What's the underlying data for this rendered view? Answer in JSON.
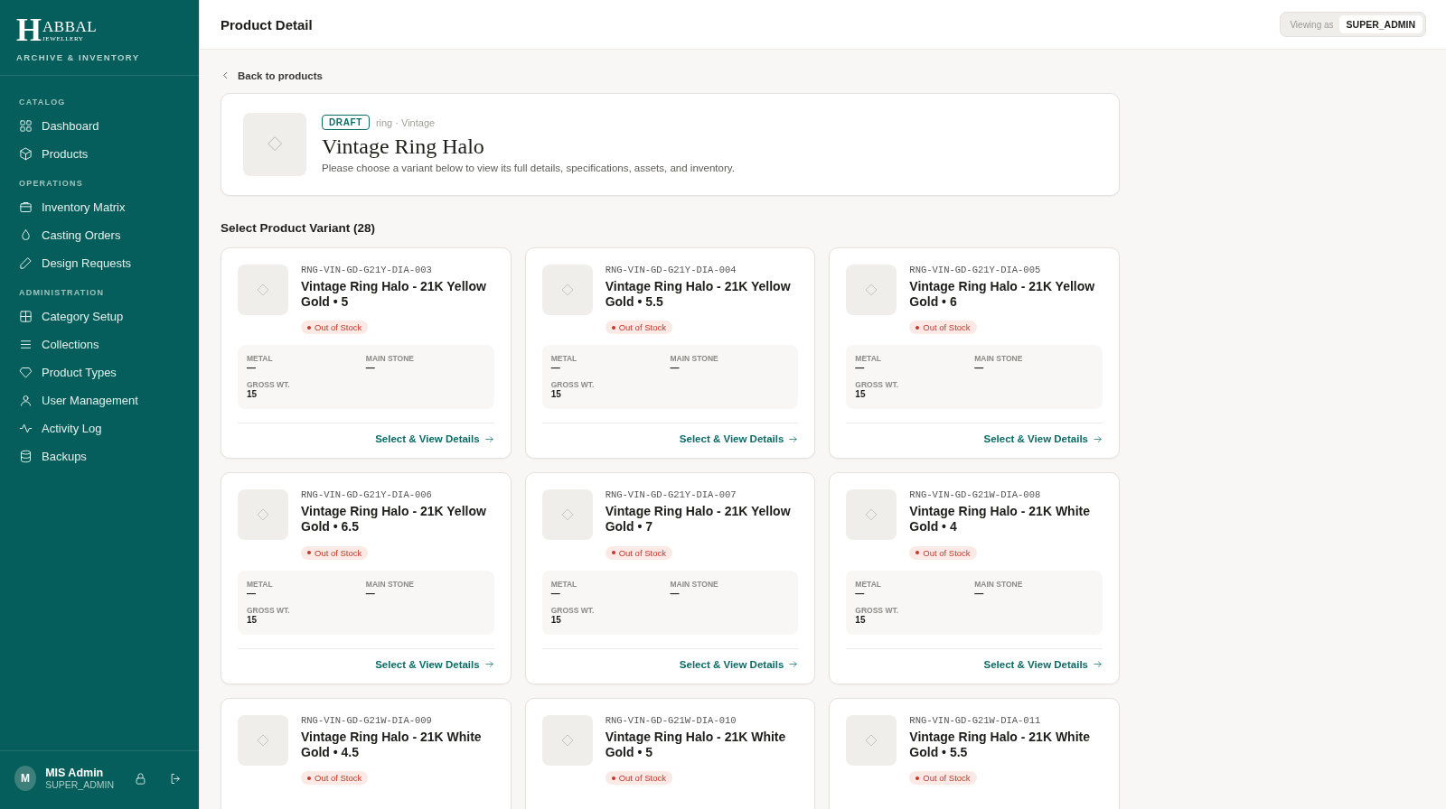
{
  "sidebar": {
    "logo": {
      "initial": "H",
      "name": "ABBAL",
      "sub": "JEWELLERY"
    },
    "tagline": "ARCHIVE & INVENTORY",
    "sections": [
      {
        "title": "CATALOG",
        "items": [
          {
            "label": "Dashboard",
            "selected": false
          },
          {
            "label": "Products",
            "selected": false
          }
        ]
      },
      {
        "title": "OPERATIONS",
        "items": [
          {
            "label": "Inventory Matrix",
            "selected": false
          },
          {
            "label": "Casting Orders",
            "selected": false
          },
          {
            "label": "Design Requests",
            "selected": false
          }
        ]
      },
      {
        "title": "ADMINISTRATION",
        "items": [
          {
            "label": "Category Setup",
            "selected": false
          },
          {
            "label": "Collections",
            "selected": false
          },
          {
            "label": "Product Types",
            "selected": false
          },
          {
            "label": "User Management",
            "selected": false
          },
          {
            "label": "Activity Log",
            "selected": false
          },
          {
            "label": "Backups",
            "selected": false
          }
        ]
      }
    ],
    "user": {
      "initial": "M",
      "name": "MIS Admin",
      "role": "SUPER_ADMIN"
    }
  },
  "header": {
    "title": "Product Detail",
    "viewing_label": "Viewing as",
    "viewing_role": "SUPER_ADMIN"
  },
  "back_link": "Back to products",
  "product": {
    "status": "DRAFT",
    "meta": "ring · Vintage",
    "name": "Vintage Ring Halo",
    "description": "Please choose a variant below to view its full details, specifications, assets, and inventory."
  },
  "variants_title": "Select Product Variant (28)",
  "variants": [
    {
      "sku": "RNG-VIN-GD-G21Y-DIA-003",
      "name": "Vintage Ring Halo - 21K Yellow Gold • 5",
      "stock": "Out of Stock",
      "specs": [
        {
          "label": "METAL",
          "value": "—"
        },
        {
          "label": "MAIN STONE",
          "value": "—"
        },
        {
          "label": "GROSS WT.",
          "value": "15"
        }
      ],
      "action": "Select & View Details"
    },
    {
      "sku": "RNG-VIN-GD-G21Y-DIA-004",
      "name": "Vintage Ring Halo - 21K Yellow Gold • 5.5",
      "stock": "Out of Stock",
      "specs": [
        {
          "label": "METAL",
          "value": "—"
        },
        {
          "label": "MAIN STONE",
          "value": "—"
        },
        {
          "label": "GROSS WT.",
          "value": "15"
        }
      ],
      "action": "Select & View Details"
    },
    {
      "sku": "RNG-VIN-GD-G21Y-DIA-005",
      "name": "Vintage Ring Halo - 21K Yellow Gold • 6",
      "stock": "Out of Stock",
      "specs": [
        {
          "label": "METAL",
          "value": "—"
        },
        {
          "label": "MAIN STONE",
          "value": "—"
        },
        {
          "label": "GROSS WT.",
          "value": "15"
        }
      ],
      "action": "Select & View Details"
    },
    {
      "sku": "RNG-VIN-GD-G21Y-DIA-006",
      "name": "Vintage Ring Halo - 21K Yellow Gold • 6.5",
      "stock": "Out of Stock",
      "specs": [
        {
          "label": "METAL",
          "value": "—"
        },
        {
          "label": "MAIN STONE",
          "value": "—"
        },
        {
          "label": "GROSS WT.",
          "value": "15"
        }
      ],
      "action": "Select & View Details"
    },
    {
      "sku": "RNG-VIN-GD-G21Y-DIA-007",
      "name": "Vintage Ring Halo - 21K Yellow Gold • 7",
      "stock": "Out of Stock",
      "specs": [
        {
          "label": "METAL",
          "value": "—"
        },
        {
          "label": "MAIN STONE",
          "value": "—"
        },
        {
          "label": "GROSS WT.",
          "value": "15"
        }
      ],
      "action": "Select & View Details"
    },
    {
      "sku": "RNG-VIN-GD-G21W-DIA-008",
      "name": "Vintage Ring Halo - 21K White Gold • 4",
      "stock": "Out of Stock",
      "specs": [
        {
          "label": "METAL",
          "value": "—"
        },
        {
          "label": "MAIN STONE",
          "value": "—"
        },
        {
          "label": "GROSS WT.",
          "value": "15"
        }
      ],
      "action": "Select & View Details"
    },
    {
      "sku": "RNG-VIN-GD-G21W-DIA-009",
      "name": "Vintage Ring Halo - 21K White Gold • 4.5",
      "stock": "Out of Stock"
    },
    {
      "sku": "RNG-VIN-GD-G21W-DIA-010",
      "name": "Vintage Ring Halo - 21K White Gold • 5",
      "stock": "Out of Stock"
    },
    {
      "sku": "RNG-VIN-GD-G21W-DIA-011",
      "name": "Vintage Ring Halo - 21K White Gold • 5.5",
      "stock": "Out of Stock"
    }
  ]
}
